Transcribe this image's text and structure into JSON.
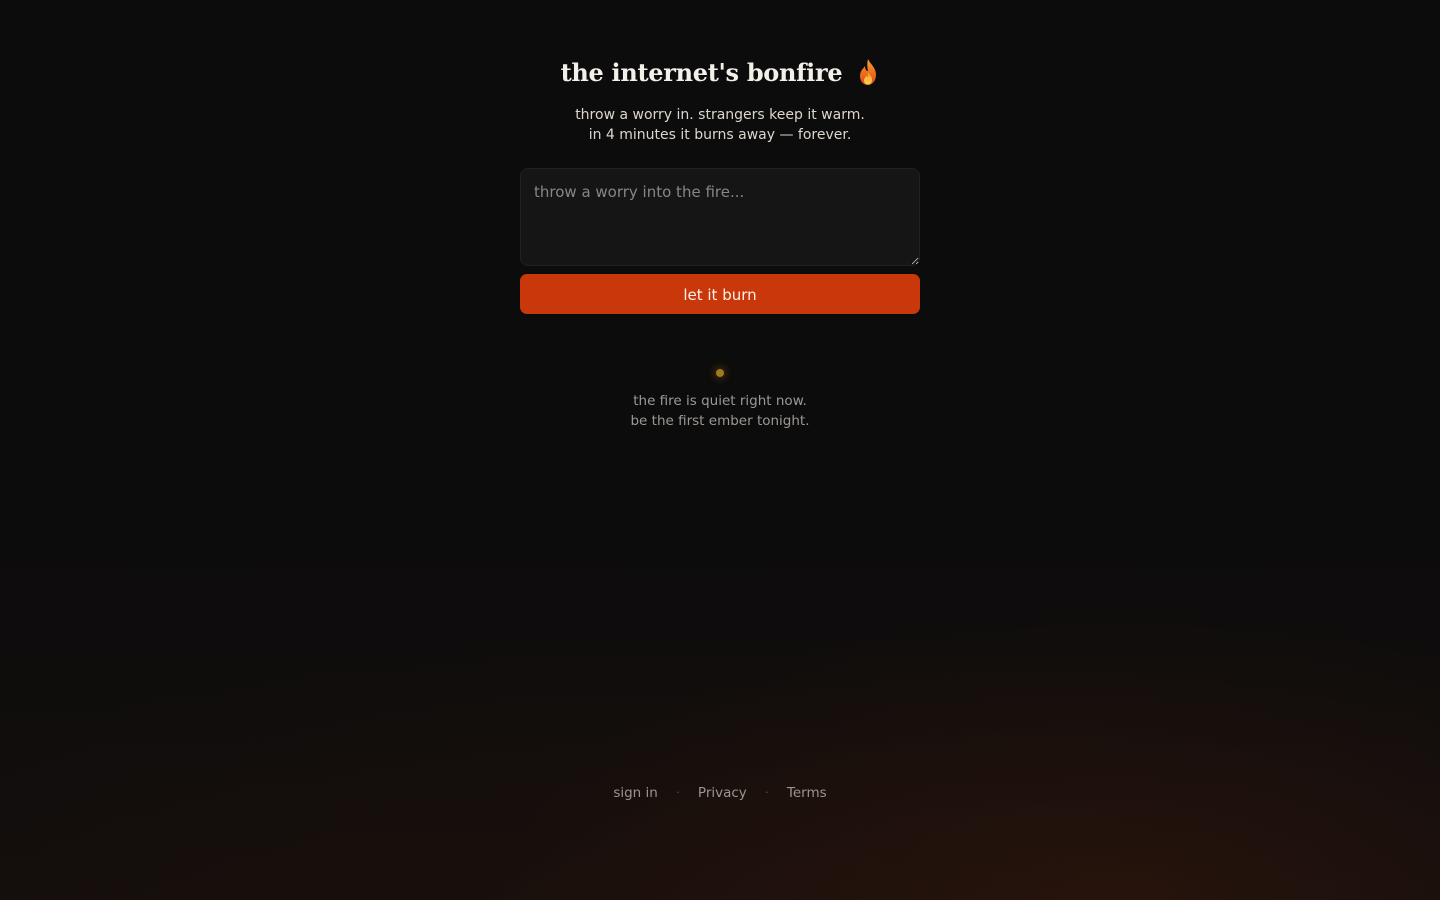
{
  "header": {
    "title": "the internet's bonfire",
    "title_icon": "flame-icon"
  },
  "subtitle": {
    "line1": "throw a worry in. strangers keep it warm.",
    "line2": "in 4 minutes it burns away — forever."
  },
  "composer": {
    "placeholder": "throw a worry into the fire...",
    "value": "",
    "submit_label": "let it burn"
  },
  "status": {
    "line1": "the fire is quiet right now.",
    "line2": "be the first ember tonight."
  },
  "footer": {
    "links": [
      "sign in",
      "Privacy",
      "Terms"
    ],
    "separator": "·"
  },
  "colors": {
    "background": "#0c0c0c",
    "accent": "#c9380a",
    "ember": "#a07a1e"
  }
}
